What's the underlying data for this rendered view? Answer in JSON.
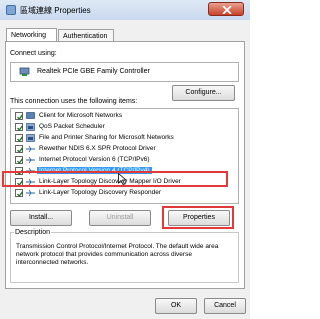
{
  "window": {
    "title": "區域連線 Properties",
    "close_icon": "close-icon",
    "colors": {
      "titlebar": "#c9d9ee",
      "close": "#c7412a",
      "highlight": "#e23a3a",
      "selection": "#3399ff"
    }
  },
  "tabs": [
    {
      "label": "Networking",
      "active": true
    },
    {
      "label": "Authentication",
      "active": false
    }
  ],
  "connect_using": {
    "label": "Connect using:",
    "adapter": "Realtek PCIe GBE Family Controller",
    "configure_label": "Configure..."
  },
  "items_label": "This connection uses the following items:",
  "items": [
    {
      "label": "Client for Microsoft Networks",
      "checked": true,
      "icon": "network-client-icon",
      "selected": false
    },
    {
      "label": "QoS Packet Scheduler",
      "checked": true,
      "icon": "service-icon",
      "selected": false
    },
    {
      "label": "File and Printer Sharing for Microsoft Networks",
      "checked": true,
      "icon": "service-icon",
      "selected": false
    },
    {
      "label": "Rewether NDIS 6.X SPR Protocol Driver",
      "checked": true,
      "icon": "protocol-icon",
      "selected": false
    },
    {
      "label": "Internet Protocol Version 6 (TCP/IPv6)",
      "checked": true,
      "icon": "protocol-icon",
      "selected": false
    },
    {
      "label": "Internet Protocol Version 4 (TCP/IPv4)",
      "checked": true,
      "icon": "protocol-icon",
      "selected": true
    },
    {
      "label": "Link-Layer Topology Discovery Mapper I/O Driver",
      "checked": true,
      "icon": "protocol-icon",
      "selected": false
    },
    {
      "label": "Link-Layer Topology Discovery Responder",
      "checked": true,
      "icon": "protocol-icon",
      "selected": false
    }
  ],
  "actions": {
    "install_label": "Install...",
    "uninstall_label": "Uninstall",
    "properties_label": "Properties"
  },
  "description": {
    "title": "Description",
    "text": "Transmission Control Protocol/Internet Protocol. The default wide area network protocol that provides communication across diverse interconnected networks."
  },
  "footer": {
    "ok_label": "OK",
    "cancel_label": "Cancel"
  }
}
